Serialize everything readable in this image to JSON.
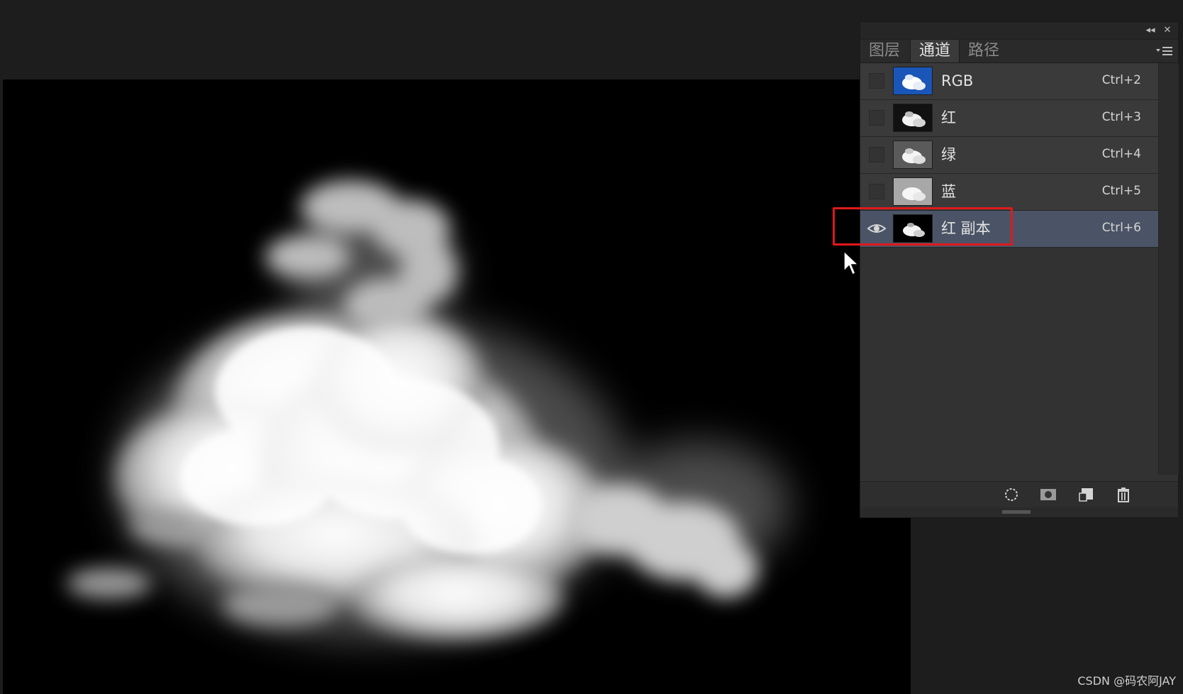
{
  "panel": {
    "tabs": [
      {
        "label": "图层",
        "active": false
      },
      {
        "label": "通道",
        "active": true
      },
      {
        "label": "路径",
        "active": false
      }
    ],
    "topbar": {
      "collapse_icon": "double-chevron-left-icon",
      "close_icon": "close-icon"
    },
    "channels": [
      {
        "name": "RGB",
        "shortcut": "Ctrl+2",
        "visible": false,
        "selected": false,
        "thumb": "blue-sky-cloud"
      },
      {
        "name": "红",
        "shortcut": "Ctrl+3",
        "visible": false,
        "selected": false,
        "thumb": "dark-cloud"
      },
      {
        "name": "绿",
        "shortcut": "Ctrl+4",
        "visible": false,
        "selected": false,
        "thumb": "gray-cloud"
      },
      {
        "name": "蓝",
        "shortcut": "Ctrl+5",
        "visible": false,
        "selected": false,
        "thumb": "light-cloud"
      },
      {
        "name": "红 副本",
        "shortcut": "Ctrl+6",
        "visible": true,
        "selected": true,
        "thumb": "black-cloud"
      }
    ],
    "footer_icons": [
      "load-selection-icon",
      "save-selection-mask-icon",
      "new-channel-icon",
      "delete-channel-icon"
    ]
  },
  "colors": {
    "highlight": "#e0191b",
    "selected_row": "#4a5466",
    "panel_bg": "#323232"
  },
  "watermark": "CSDN @码农阿JAY"
}
